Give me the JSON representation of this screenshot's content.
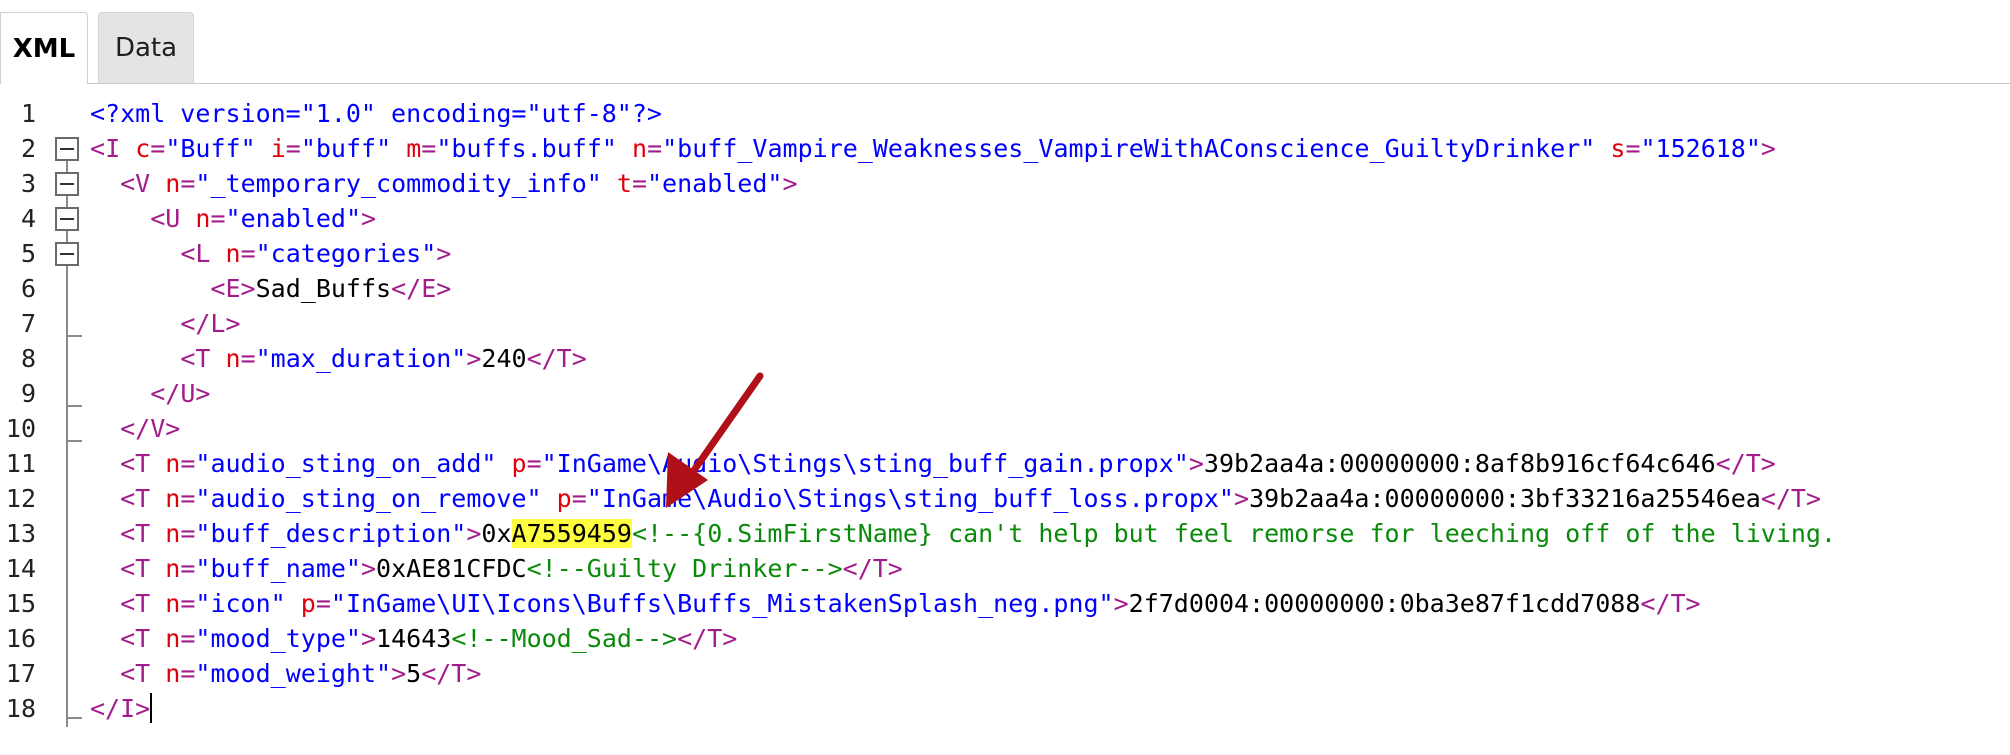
{
  "tabs": [
    {
      "label": "XML",
      "active": true
    },
    {
      "label": "Data",
      "active": false
    }
  ],
  "line_numbers": [
    "1",
    "2",
    "3",
    "4",
    "5",
    "6",
    "7",
    "8",
    "9",
    "10",
    "11",
    "12",
    "13",
    "14",
    "15",
    "16",
    "17",
    "18"
  ],
  "code": {
    "l1": "<?xml version=\"1.0\" encoding=\"utf-8\"?>",
    "l2": {
      "tag": "I",
      "c": "\"Buff\"",
      "i": "\"buff\"",
      "m": "\"buffs.buff\"",
      "n": "\"buff_Vampire_Weaknesses_VampireWithAConscience_GuiltyDrinker\"",
      "s": "\"152618\""
    },
    "l3": {
      "tag": "V",
      "n": "\"_temporary_commodity_info\"",
      "t": "\"enabled\""
    },
    "l4": {
      "tag": "U",
      "n": "\"enabled\""
    },
    "l5": {
      "tag": "L",
      "n": "\"categories\""
    },
    "l6": {
      "tag": "E",
      "text": "Sad_Buffs"
    },
    "l7": {
      "close": "</L>"
    },
    "l8": {
      "tag": "T",
      "n": "\"max_duration\"",
      "text": "240"
    },
    "l9": {
      "close": "</U>"
    },
    "l10": {
      "close": "</V>"
    },
    "l11": {
      "n": "\"audio_sting_on_add\"",
      "p": "\"InGame\\Audio\\Stings\\sting_buff_gain.propx\"",
      "text": "39b2aa4a:00000000:8af8b916cf64c646"
    },
    "l12": {
      "n": "\"audio_sting_on_remove\"",
      "p": "\"InGame\\Audio\\Stings\\sting_buff_loss.propx\"",
      "text": "39b2aa4a:00000000:3bf33216a25546ea"
    },
    "l13": {
      "n": "\"buff_description\"",
      "prefix": "0x",
      "highlight": "A7559459",
      "comment": "<!--{0.SimFirstName} can't help but feel remorse for leeching off of the living."
    },
    "l14": {
      "n": "\"buff_name\"",
      "text": "0xAE81CFDC",
      "comment": "<!--Guilty Drinker-->"
    },
    "l15": {
      "n": "\"icon\"",
      "p": "\"InGame\\UI\\Icons\\Buffs\\Buffs_MistakenSplash_neg.png\"",
      "text": "2f7d0004:00000000:0ba3e87f1cdd7088"
    },
    "l16": {
      "n": "\"mood_type\"",
      "text": "14643",
      "comment": "<!--Mood_Sad-->"
    },
    "l17": {
      "n": "\"mood_weight\"",
      "text": "5"
    },
    "l18": {
      "close": "</I>"
    }
  },
  "annotation": {
    "type": "arrow",
    "color": "#b01018"
  }
}
